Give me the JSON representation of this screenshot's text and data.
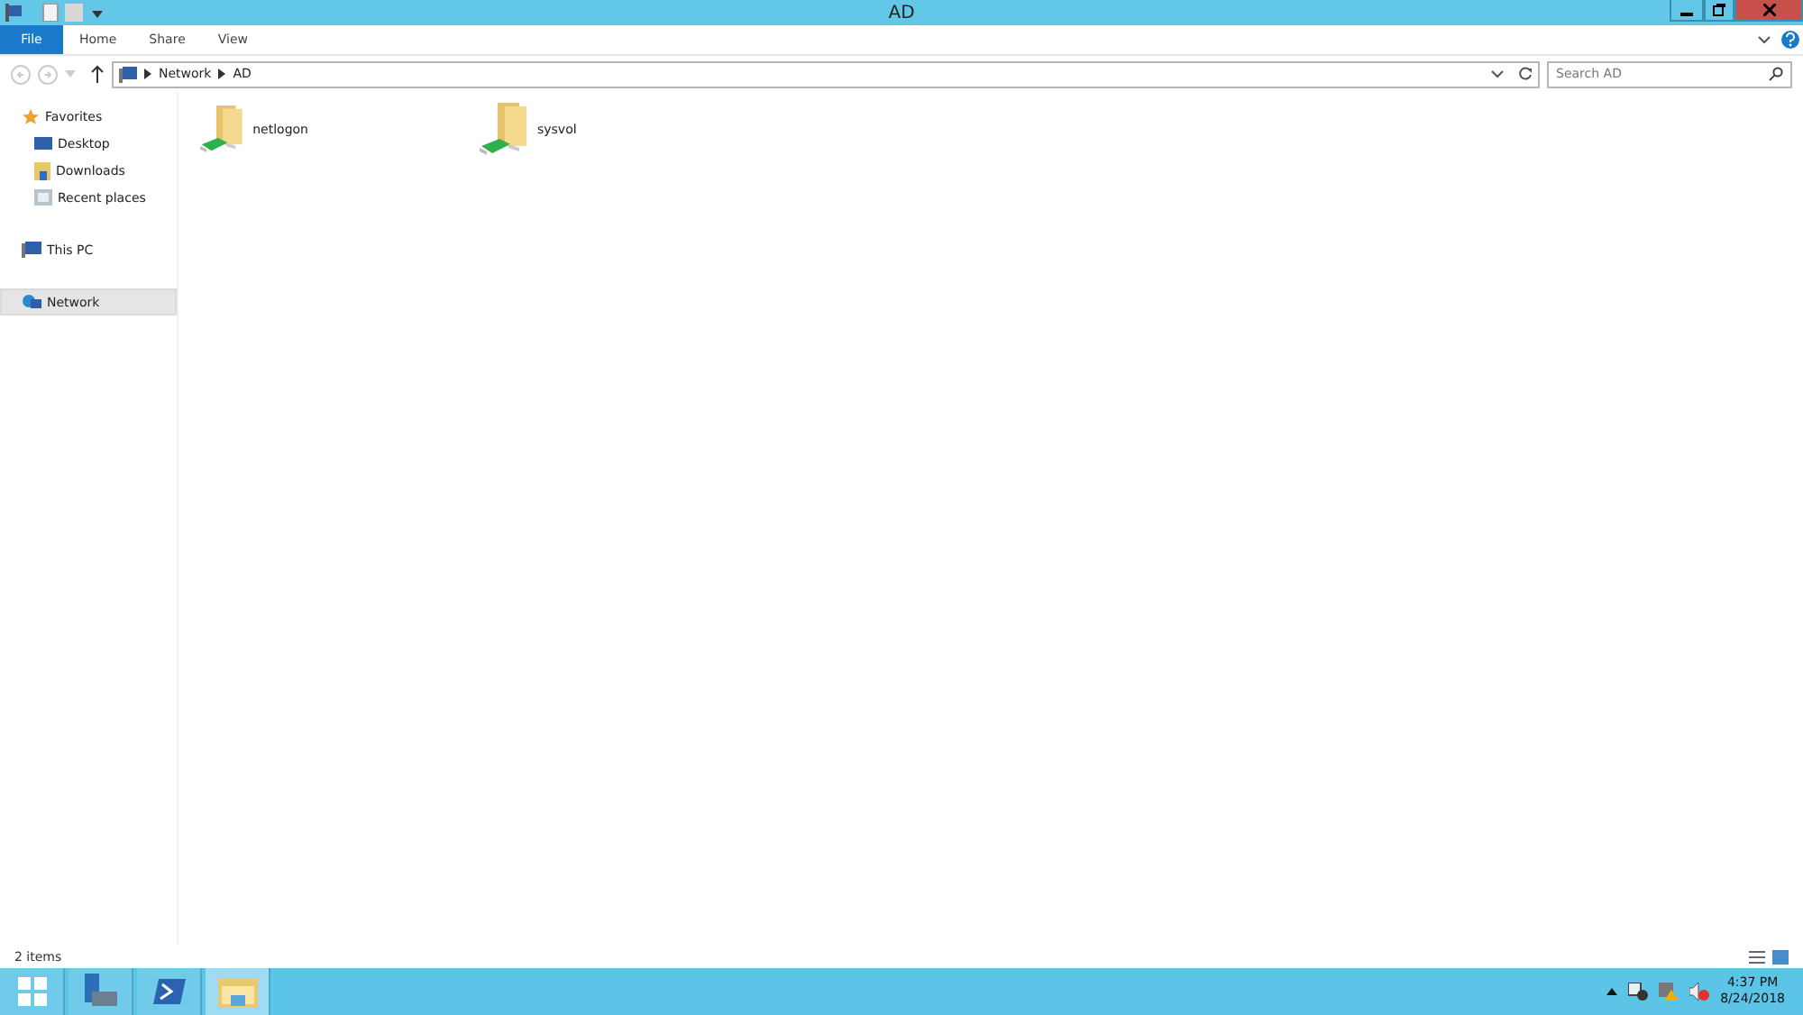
{
  "window": {
    "title": "AD"
  },
  "ribbon": {
    "file_tab": "File",
    "tabs": [
      {
        "label": "Home",
        "selected": false
      },
      {
        "label": "Share",
        "selected": false
      },
      {
        "label": "View",
        "selected": false
      }
    ]
  },
  "address_bar": {
    "path": [
      "Network",
      "AD"
    ],
    "search_placeholder": "Search AD"
  },
  "sidebar": {
    "items": [
      {
        "label": "Favorites",
        "kind": "star",
        "selected": false,
        "children": [
          {
            "label": "Desktop",
            "kind": "desktop",
            "selected": false
          },
          {
            "label": "Downloads",
            "kind": "downloads",
            "selected": false
          },
          {
            "label": "Recent places",
            "kind": "recent",
            "selected": false
          }
        ]
      },
      {
        "label": "This PC",
        "kind": "pc",
        "selected": false
      },
      {
        "label": "Network",
        "kind": "network",
        "selected": true
      }
    ]
  },
  "files": [
    {
      "name": "netlogon"
    },
    {
      "name": "sysvol"
    }
  ],
  "status_bar": {
    "text": "2 items"
  },
  "taskbar": {
    "apps": [
      {
        "kind": "server",
        "selected": false
      },
      {
        "kind": "powershell",
        "selected": false
      },
      {
        "kind": "explorer",
        "selected": true
      }
    ],
    "time": "4:37 PM",
    "date": "8/24/2018"
  }
}
